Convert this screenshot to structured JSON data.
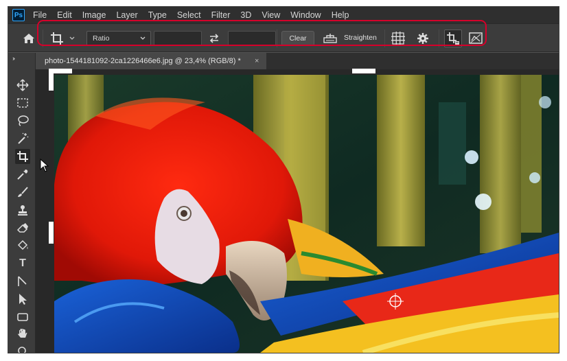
{
  "app": {
    "logo": "Ps"
  },
  "menu": [
    "File",
    "Edit",
    "Image",
    "Layer",
    "Type",
    "Select",
    "Filter",
    "3D",
    "View",
    "Window",
    "Help"
  ],
  "options_bar": {
    "ratio_value": "Ratio",
    "width_value": "",
    "height_value": "",
    "clear_label": "Clear",
    "straighten_label": "Straighten"
  },
  "document": {
    "tab_title": "photo-1544181092-2ca1226466e6.jpg @ 23,4% (RGB/8) *",
    "tab_close": "×"
  },
  "toolbar": {
    "collapse": "››",
    "type_tool": "T"
  },
  "colors": {
    "highlight": "#d6002a",
    "app_bg": "#535353",
    "menubar": "#2f2f2f",
    "optionsbar": "#3c3c3c"
  },
  "icons": [
    "home-icon",
    "crop-icon",
    "swap-icon",
    "straighten-icon",
    "grid-overlay-icon",
    "gear-icon",
    "delete-cropped-pixels-icon",
    "content-aware-icon",
    "move-icon",
    "marquee-icon",
    "lasso-icon",
    "magic-wand-icon",
    "crop-tool-icon",
    "eyedropper-icon",
    "brush-icon",
    "stamp-icon",
    "eraser-icon",
    "paint-bucket-icon",
    "type-icon",
    "pen-icon",
    "path-selection-icon",
    "rectangle-icon",
    "hand-icon",
    "zoom-icon"
  ]
}
